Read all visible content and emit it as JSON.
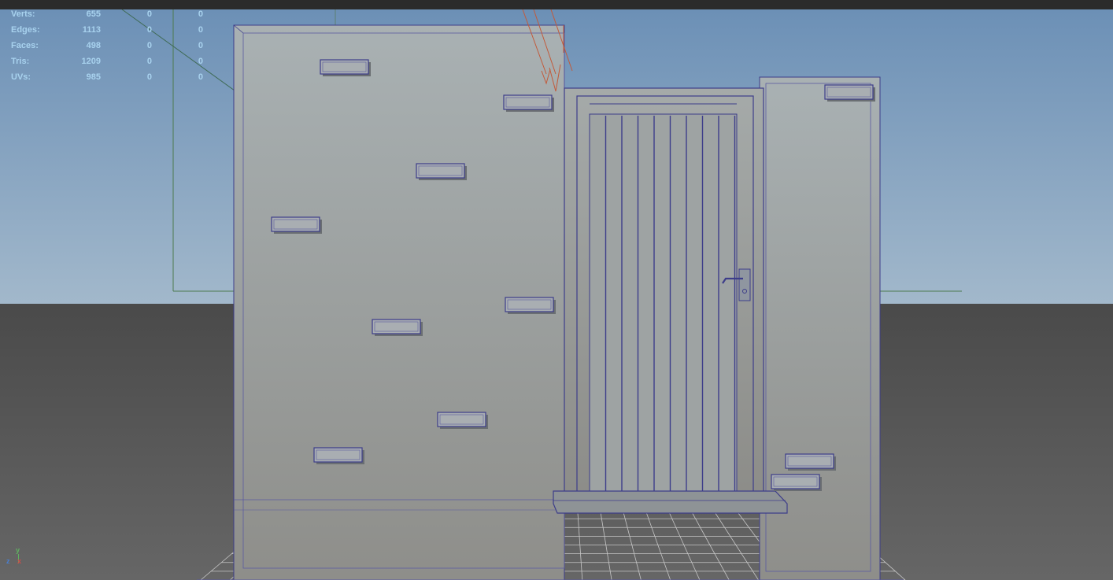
{
  "hud": {
    "rows": [
      {
        "label": "Verts:",
        "v1": "655",
        "v2": "0",
        "v3": "0"
      },
      {
        "label": "Edges:",
        "v1": "1113",
        "v2": "0",
        "v3": "0"
      },
      {
        "label": "Faces:",
        "v1": "498",
        "v2": "0",
        "v3": "0"
      },
      {
        "label": "Tris:",
        "v1": "1209",
        "v2": "0",
        "v3": "0"
      },
      {
        "label": "UVs:",
        "v1": "985",
        "v2": "0",
        "v3": "0"
      }
    ]
  },
  "axis": {
    "y_label": "y",
    "z_label": "z",
    "x_label": "x"
  },
  "colors": {
    "sky_top": "#6f93b8",
    "sky_bottom": "#9db4c8",
    "ground": "#555555",
    "wall": "#a3a9a9",
    "wireframe": "#3d3d8a",
    "hud_text": "#a8d2ee",
    "axis_green": "#5fb05f"
  }
}
